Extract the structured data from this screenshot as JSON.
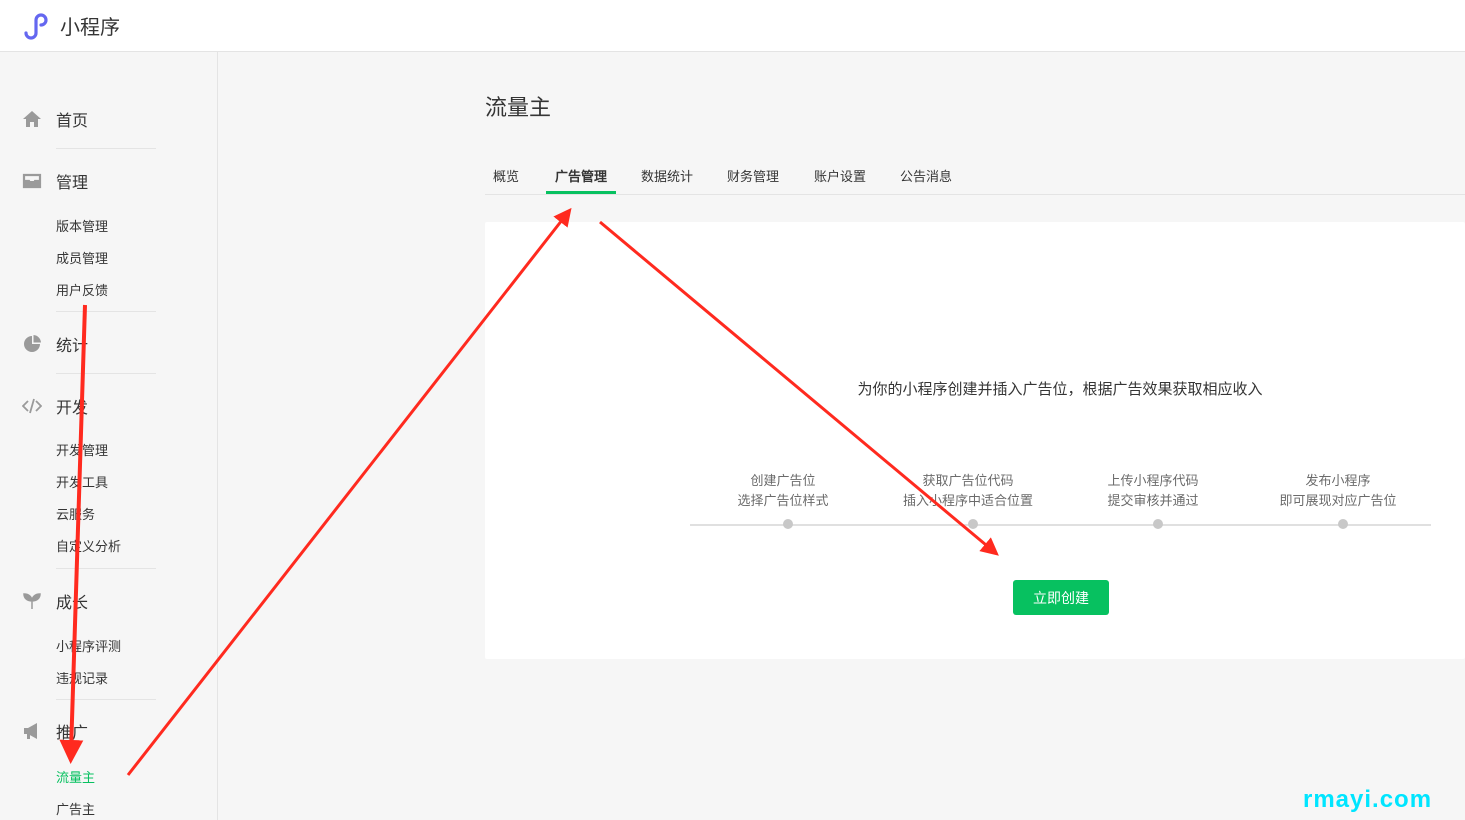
{
  "app": {
    "title": "小程序",
    "logo_icon": "mini-program-logo-icon",
    "accent_color": "#07c160"
  },
  "sidebar": {
    "sections": [
      {
        "label": "首页",
        "icon": "home-icon",
        "items": []
      },
      {
        "label": "管理",
        "icon": "inbox-icon",
        "items": [
          "版本管理",
          "成员管理",
          "用户反馈"
        ]
      },
      {
        "label": "统计",
        "icon": "pie-chart-icon",
        "items": []
      },
      {
        "label": "开发",
        "icon": "code-icon",
        "items": [
          "开发管理",
          "开发工具",
          "云服务",
          "自定义分析"
        ]
      },
      {
        "label": "成长",
        "icon": "sprout-icon",
        "items": [
          "小程序评测",
          "违规记录"
        ]
      },
      {
        "label": "推广",
        "icon": "megaphone-icon",
        "items": [
          "流量主",
          "广告主"
        ]
      }
    ],
    "active_item": "流量主"
  },
  "main": {
    "title": "流量主",
    "tabs": [
      "概览",
      "广告管理",
      "数据统计",
      "财务管理",
      "账户设置",
      "公告消息"
    ],
    "active_tab": "广告管理",
    "intro": "为你的小程序创建并插入广告位，根据广告效果获取相应收入",
    "steps": [
      {
        "title": "创建广告位",
        "desc": "选择广告位样式"
      },
      {
        "title": "获取广告位代码",
        "desc": "插入小程序中适合位置"
      },
      {
        "title": "上传小程序代码",
        "desc": "提交审核并通过"
      },
      {
        "title": "发布小程序",
        "desc": "即可展现对应广告位"
      }
    ],
    "create_button": "立即创建"
  },
  "watermark": "rmayi.com",
  "annotation_color": "#ff2a1f"
}
